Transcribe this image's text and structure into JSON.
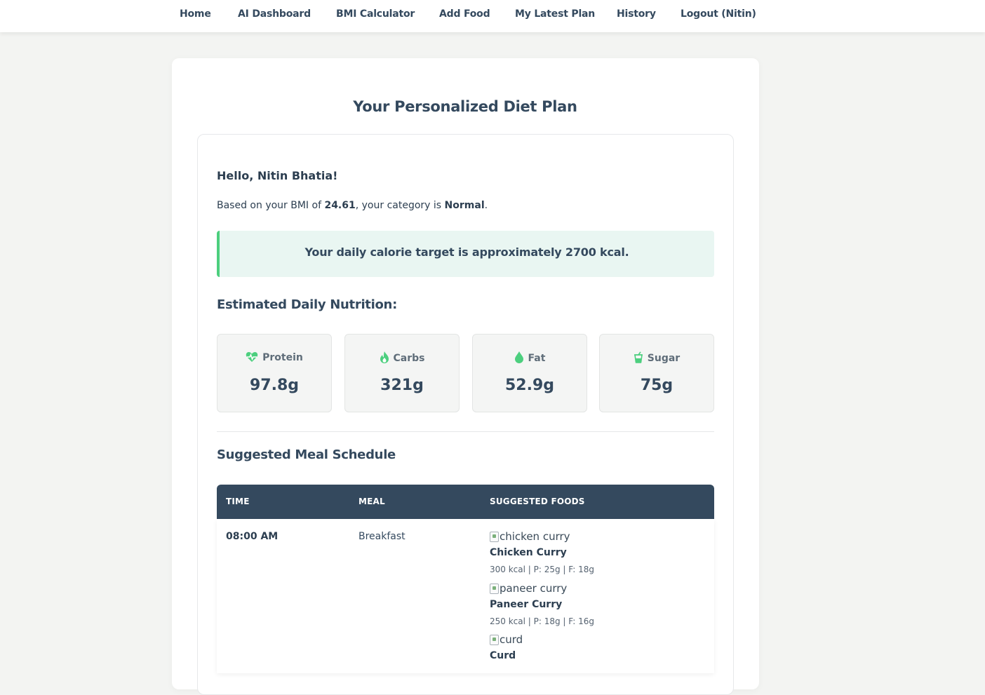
{
  "nav": {
    "home": "Home",
    "ai_dashboard": "AI Dashboard",
    "bmi_calculator": "BMI Calculator",
    "add_food": "Add Food",
    "my_latest_plan": "My Latest Plan",
    "history": "History",
    "logout": "Logout (Nitin)"
  },
  "page_title": "Your Personalized Diet Plan",
  "greeting": "Hello, Nitin Bhatia!",
  "bmi": {
    "prefix": "Based on your BMI of ",
    "value": "24.61",
    "middle": ", your category is ",
    "category": "Normal",
    "suffix": "."
  },
  "calorie_target": {
    "prefix": "Your daily calorie target is approximately ",
    "value": "2700 kcal."
  },
  "nutrition": {
    "heading": "Estimated Daily Nutrition:",
    "items": [
      {
        "label": "Protein",
        "value": "97.8g",
        "icon": "heart-pulse-icon"
      },
      {
        "label": "Carbs",
        "value": "321g",
        "icon": "flame-icon"
      },
      {
        "label": "Fat",
        "value": "52.9g",
        "icon": "droplet-icon"
      },
      {
        "label": "Sugar",
        "value": "75g",
        "icon": "cup-icon"
      }
    ],
    "icon_color": "#4ccf7e"
  },
  "meals": {
    "heading": "Suggested Meal Schedule",
    "columns": [
      "TIME",
      "MEAL",
      "SUGGESTED FOODS"
    ],
    "rows": [
      {
        "time": "08:00 AM",
        "meal": "Breakfast",
        "foods": [
          {
            "alt": "chicken curry",
            "name": "Chicken Curry",
            "macros": "300 kcal | P: 25g | F: 18g"
          },
          {
            "alt": "paneer curry",
            "name": "Paneer Curry",
            "macros": "250 kcal | P: 18g | F: 16g"
          },
          {
            "alt": "curd",
            "name": "Curd",
            "macros": ""
          }
        ]
      }
    ]
  },
  "colors": {
    "accent": "#4ccf7e",
    "dark": "#34495e",
    "target_bg": "#e9f6f2"
  }
}
